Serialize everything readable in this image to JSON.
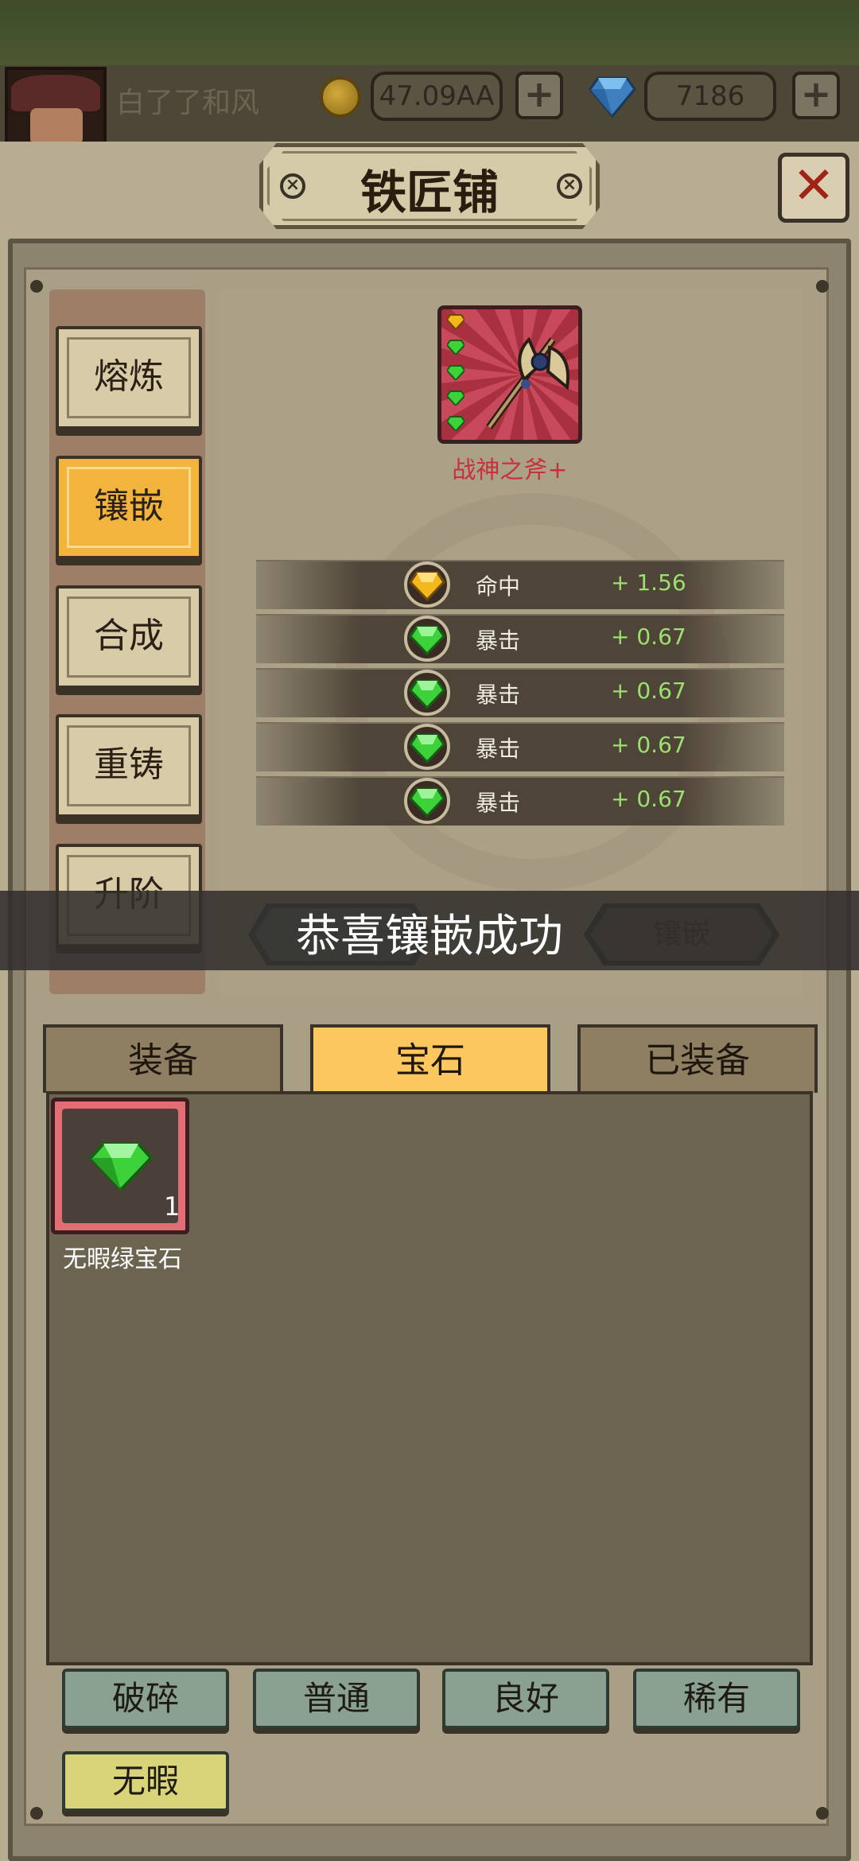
{
  "player": {
    "name": "白了了和风"
  },
  "currency": {
    "gold": "47.09AA",
    "diamonds": "7186",
    "plus": "+"
  },
  "title": "铁匠铺",
  "close_label": "✕",
  "side_tabs": [
    {
      "label": "熔炼",
      "active": false
    },
    {
      "label": "镶嵌",
      "active": true
    },
    {
      "label": "合成",
      "active": false
    },
    {
      "label": "重铸",
      "active": false
    },
    {
      "label": "升阶",
      "active": false
    }
  ],
  "item": {
    "name": "战神之斧+",
    "socket_icons": [
      "yellow-gem-icon",
      "green-gem-icon",
      "green-gem-icon",
      "green-gem-icon",
      "green-gem-icon"
    ]
  },
  "stats": [
    {
      "gem": "yellow-gem-icon",
      "label": "命中",
      "value": "+ 1.56"
    },
    {
      "gem": "green-gem-icon",
      "label": "暴击",
      "value": "+ 0.67"
    },
    {
      "gem": "green-gem-icon",
      "label": "暴击",
      "value": "+ 0.67"
    },
    {
      "gem": "green-gem-icon",
      "label": "暴击",
      "value": "+ 0.67"
    },
    {
      "gem": "green-gem-icon",
      "label": "暴击",
      "value": "+ 0.67"
    }
  ],
  "banner": {
    "text": "恭喜镶嵌成功",
    "inlay_button": "镶嵌"
  },
  "bottom_tabs": [
    {
      "label": "装备",
      "active": false
    },
    {
      "label": "宝石",
      "active": true
    },
    {
      "label": "已装备",
      "active": false
    }
  ],
  "inventory": [
    {
      "name": "无暇绿宝石",
      "count": "1",
      "icon": "green-gem-icon"
    }
  ],
  "filters": [
    {
      "label": "破碎"
    },
    {
      "label": "普通"
    },
    {
      "label": "良好"
    },
    {
      "label": "稀有"
    },
    {
      "label": "无暇"
    }
  ],
  "colors": {
    "active_tab": "#f2b43c",
    "item_name": "#c8303c",
    "stat_value": "#9ce070",
    "filter_default": "#8aa090",
    "filter_selected": "#d9d47a"
  }
}
